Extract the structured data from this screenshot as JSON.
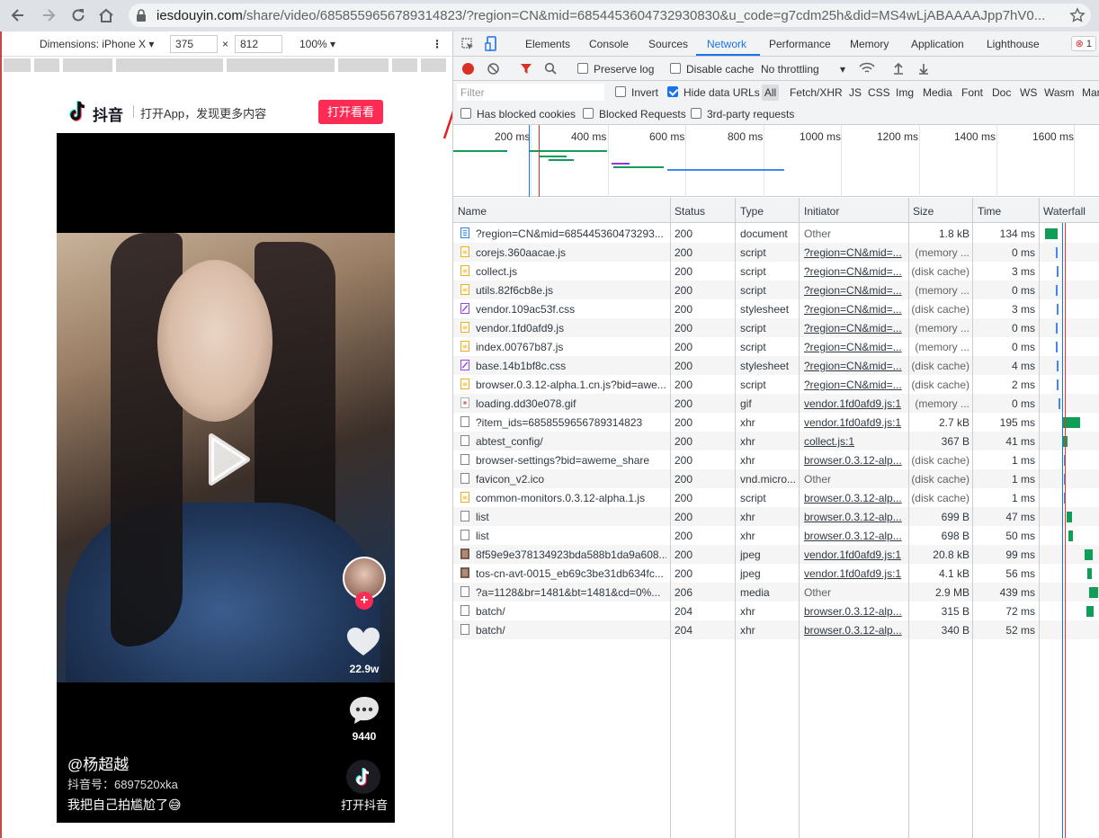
{
  "browser": {
    "url_domain": "iesdouyin.com",
    "url_rest": "/share/video/6858559656789314823/?region=CN&mid=6854453604732930830&u_code=g7cdm25h&did=MS4wLjABAAAAJpp7hV0..."
  },
  "device_toolbar": {
    "dimensions_label": "Dimensions: iPhone X",
    "width": "375",
    "times": "×",
    "height": "812",
    "zoom": "100%"
  },
  "page": {
    "brand": "抖音",
    "slogan": "打开App，发现更多内容",
    "open_button": "打开看看",
    "likes": "22.9w",
    "comments": "9440",
    "author": "@杨超越",
    "douyin_id": "抖音号：6897520xka",
    "caption": "我把自己拍尴尬了😅",
    "open_app": "打开抖音"
  },
  "devtools": {
    "tabs": [
      "Elements",
      "Console",
      "Sources",
      "Network",
      "Performance",
      "Memory",
      "Application",
      "Lighthouse"
    ],
    "active_tab": "Network",
    "error_count": "1",
    "preserve_log": "Preserve log",
    "disable_cache": "Disable cache",
    "throttling": "No throttling",
    "filter_placeholder": "Filter",
    "invert": "Invert",
    "hide_data_urls": "Hide data URLs",
    "type_filters": [
      "All",
      "Fetch/XHR",
      "JS",
      "CSS",
      "Img",
      "Media",
      "Font",
      "Doc",
      "WS",
      "Wasm",
      "Man"
    ],
    "blocked_cookies": "Has blocked cookies",
    "blocked_requests": "Blocked Requests",
    "third_party": "3rd-party requests",
    "timeline_ticks": [
      "200 ms",
      "400 ms",
      "600 ms",
      "800 ms",
      "1000 ms",
      "1200 ms",
      "1400 ms",
      "1600 ms"
    ],
    "columns": [
      "Name",
      "Status",
      "Type",
      "Initiator",
      "Size",
      "Time",
      "Waterfall"
    ],
    "rows": [
      {
        "name": "?region=CN&mid=685445360473293...",
        "status": "200",
        "type": "document",
        "initiator": "Other",
        "size": "1.8 kB",
        "time": "134 ms",
        "kind": "doc"
      },
      {
        "name": "corejs.360aacae.js",
        "status": "200",
        "type": "script",
        "initiator": "?region=CN&mid=...",
        "size": "(memory ...",
        "time": "0 ms",
        "kind": "js"
      },
      {
        "name": "collect.js",
        "status": "200",
        "type": "script",
        "initiator": "?region=CN&mid=...",
        "size": "(disk cache)",
        "time": "3 ms",
        "kind": "js"
      },
      {
        "name": "utils.82f6cb8e.js",
        "status": "200",
        "type": "script",
        "initiator": "?region=CN&mid=...",
        "size": "(memory ...",
        "time": "0 ms",
        "kind": "js"
      },
      {
        "name": "vendor.109ac53f.css",
        "status": "200",
        "type": "stylesheet",
        "initiator": "?region=CN&mid=...",
        "size": "(disk cache)",
        "time": "3 ms",
        "kind": "css"
      },
      {
        "name": "vendor.1fd0afd9.js",
        "status": "200",
        "type": "script",
        "initiator": "?region=CN&mid=...",
        "size": "(memory ...",
        "time": "0 ms",
        "kind": "js"
      },
      {
        "name": "index.00767b87.js",
        "status": "200",
        "type": "script",
        "initiator": "?region=CN&mid=...",
        "size": "(memory ...",
        "time": "0 ms",
        "kind": "js"
      },
      {
        "name": "base.14b1bf8c.css",
        "status": "200",
        "type": "stylesheet",
        "initiator": "?region=CN&mid=...",
        "size": "(disk cache)",
        "time": "4 ms",
        "kind": "css"
      },
      {
        "name": "browser.0.3.12-alpha.1.cn.js?bid=awe...",
        "status": "200",
        "type": "script",
        "initiator": "?region=CN&mid=...",
        "size": "(disk cache)",
        "time": "2 ms",
        "kind": "js"
      },
      {
        "name": "loading.dd30e078.gif",
        "status": "200",
        "type": "gif",
        "initiator": "vendor.1fd0afd9.js:1",
        "size": "(memory ...",
        "time": "0 ms",
        "kind": "img"
      },
      {
        "name": "?item_ids=6858559656789314823",
        "status": "200",
        "type": "xhr",
        "initiator": "vendor.1fd0afd9.js:1",
        "size": "2.7 kB",
        "time": "195 ms",
        "kind": "xhr"
      },
      {
        "name": "abtest_config/",
        "status": "200",
        "type": "xhr",
        "initiator": "collect.js:1",
        "size": "367 B",
        "time": "41 ms",
        "kind": "xhr"
      },
      {
        "name": "browser-settings?bid=aweme_share",
        "status": "200",
        "type": "xhr",
        "initiator": "browser.0.3.12-alp...",
        "size": "(disk cache)",
        "time": "1 ms",
        "kind": "xhr"
      },
      {
        "name": "favicon_v2.ico",
        "status": "200",
        "type": "vnd.micro...",
        "initiator": "Other",
        "size": "(disk cache)",
        "time": "1 ms",
        "kind": "xhr"
      },
      {
        "name": "common-monitors.0.3.12-alpha.1.js",
        "status": "200",
        "type": "script",
        "initiator": "browser.0.3.12-alp...",
        "size": "(disk cache)",
        "time": "1 ms",
        "kind": "js"
      },
      {
        "name": "list",
        "status": "200",
        "type": "xhr",
        "initiator": "browser.0.3.12-alp...",
        "size": "699 B",
        "time": "47 ms",
        "kind": "xhr"
      },
      {
        "name": "list",
        "status": "200",
        "type": "xhr",
        "initiator": "browser.0.3.12-alp...",
        "size": "698 B",
        "time": "50 ms",
        "kind": "xhr"
      },
      {
        "name": "8f59e9e378134923bda588b1da9a608...",
        "status": "200",
        "type": "jpeg",
        "initiator": "vendor.1fd0afd9.js:1",
        "size": "20.8 kB",
        "time": "99 ms",
        "kind": "jpg"
      },
      {
        "name": "tos-cn-avt-0015_eb69c3be31db634fc...",
        "status": "200",
        "type": "jpeg",
        "initiator": "vendor.1fd0afd9.js:1",
        "size": "4.1 kB",
        "time": "56 ms",
        "kind": "jpg"
      },
      {
        "name": "?a=1128&br=1481&bt=1481&cd=0%...",
        "status": "206",
        "type": "media",
        "initiator": "Other",
        "size": "2.9 MB",
        "time": "439 ms",
        "kind": "xhr"
      },
      {
        "name": "batch/",
        "status": "204",
        "type": "xhr",
        "initiator": "browser.0.3.12-alp...",
        "size": "315 B",
        "time": "72 ms",
        "kind": "xhr"
      },
      {
        "name": "batch/",
        "status": "204",
        "type": "xhr",
        "initiator": "browser.0.3.12-alp...",
        "size": "340 B",
        "time": "52 ms",
        "kind": "xhr"
      }
    ]
  },
  "colors": {
    "accent": "#1a73e8",
    "douyin_red": "#fe2c55",
    "record_red": "#d93025",
    "waterfall_green": "#0f9d58"
  }
}
